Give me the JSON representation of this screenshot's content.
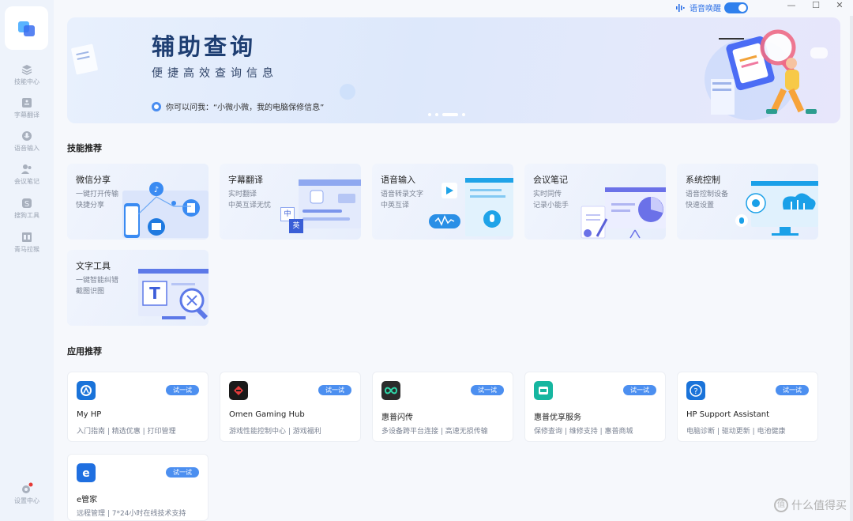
{
  "sidebar": {
    "items": [
      {
        "label": "技能中心",
        "icon": "layers-icon"
      },
      {
        "label": "字幕翻译",
        "icon": "subtitle-icon"
      },
      {
        "label": "语音输入",
        "icon": "mic-icon"
      },
      {
        "label": "会议笔记",
        "icon": "meeting-icon"
      },
      {
        "label": "搜狗工具",
        "icon": "sogou-icon"
      },
      {
        "label": "青马拉猴",
        "icon": "book-icon"
      }
    ],
    "settings_label": "设置中心"
  },
  "topbar": {
    "voice_wake_label": "语音唤醒",
    "minimize": "—",
    "maximize": "☐",
    "close": "✕"
  },
  "banner": {
    "title": "辅助查询",
    "subtitle": "便捷高效查询信息",
    "hint": "你可以问我：“小微小微，我的电脑保修信息”"
  },
  "sections": {
    "skills_title": "技能推荐",
    "apps_title": "应用推荐"
  },
  "skills": [
    {
      "title": "微信分享",
      "line1": "一键打开传输",
      "line2": "快捷分享"
    },
    {
      "title": "字幕翻译",
      "line1": "实时翻译",
      "line2": "中英互译无忧",
      "badge_zh": "中",
      "badge_en": "英"
    },
    {
      "title": "语音输入",
      "line1": "语音转录文字",
      "line2": "中英互译"
    },
    {
      "title": "会议笔记",
      "line1": "实时同传",
      "line2": "记录小能手"
    },
    {
      "title": "系统控制",
      "line1": "语音控制设备",
      "line2": "快速设置"
    },
    {
      "title": "文字工具",
      "line1": "一键智能纠错",
      "line2": "截图识图",
      "glyph": "T"
    }
  ],
  "apps": [
    {
      "name": "My HP",
      "desc": "入门指南 | 精选优惠 | 打印管理",
      "try": "试一试",
      "color": "#1a73d9"
    },
    {
      "name": "Omen Gaming Hub",
      "desc": "游戏性能控制中心 | 游戏福利",
      "try": "试一试",
      "color": "#1a1a1a"
    },
    {
      "name": "惠普闪传",
      "desc": "多设备跨平台连接 | 高速无损传输",
      "try": "试一试",
      "color": "#2b2b2b"
    },
    {
      "name": "惠普优享服务",
      "desc": "保修查询 | 维修支持 | 惠普商城",
      "try": "试一试",
      "color": "#16b6a0"
    },
    {
      "name": "HP Support Assistant",
      "desc": "电脑诊断 | 驱动更新 | 电池健康",
      "try": "试一试",
      "color": "#1a73d9"
    },
    {
      "name": "e管家",
      "desc": "远程管理 | 7*24小时在线技术支持",
      "try": "试一试",
      "color": "#1f6fe0"
    }
  ],
  "watermark": {
    "text": "什么值得买",
    "mark": "值"
  }
}
